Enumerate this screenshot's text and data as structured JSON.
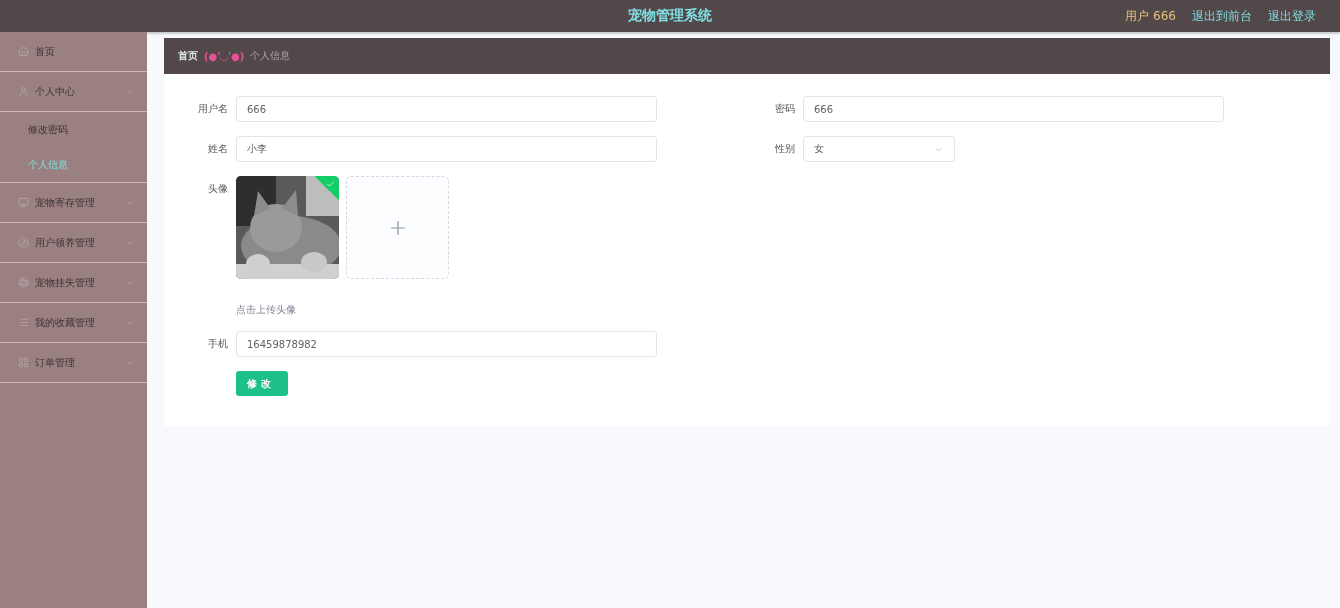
{
  "header": {
    "title": "宠物管理系统",
    "user": "用户 666",
    "links": [
      "退出到前台",
      "退出登录"
    ]
  },
  "sidebar": {
    "items": [
      {
        "label": "首页",
        "kind": "link"
      },
      {
        "label": "个人中心",
        "kind": "group",
        "expanded": true,
        "children": [
          {
            "label": "修改密码",
            "selected": false
          },
          {
            "label": "个人信息",
            "selected": true
          }
        ]
      },
      {
        "label": "宠物寄存管理",
        "kind": "group",
        "expanded": false
      },
      {
        "label": "用户领养管理",
        "kind": "group",
        "expanded": false
      },
      {
        "label": "宠物挂失管理",
        "kind": "group",
        "expanded": false
      },
      {
        "label": "我的收藏管理",
        "kind": "group",
        "expanded": false
      },
      {
        "label": "订单管理",
        "kind": "group",
        "expanded": false
      }
    ]
  },
  "breadcrumb": {
    "home": "首页",
    "separator": "(●'◡'●)",
    "current": "个人信息"
  },
  "form": {
    "rows": [
      [
        {
          "kind": "text",
          "label": "用户名",
          "value": "666"
        },
        {
          "kind": "text",
          "label": "密码",
          "value": "666"
        }
      ],
      [
        {
          "kind": "text",
          "label": "姓名",
          "value": "小李"
        },
        {
          "kind": "select",
          "label": "性别",
          "value": "女"
        }
      ],
      [
        {
          "label": "头像",
          "uploaded": true,
          "hint": "点击上传头像"
        }
      ],
      [
        {
          "kind": "text",
          "label": "手机",
          "value": "16459878982"
        }
      ]
    ],
    "submit": "修改"
  }
}
